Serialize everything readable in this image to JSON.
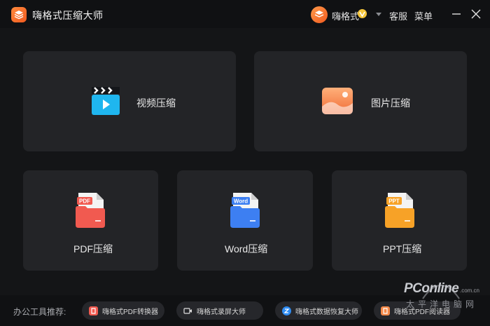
{
  "app": {
    "title": "嗨格式压缩大师"
  },
  "user": {
    "name": "嗨格式"
  },
  "header": {
    "support_label": "客服",
    "menu_label": "菜单"
  },
  "cards": {
    "video": {
      "label": "视频压缩"
    },
    "image": {
      "label": "图片压缩"
    },
    "pdf": {
      "label": "PDF压缩",
      "badge": "PDF"
    },
    "word": {
      "label": "Word压缩",
      "badge": "Word"
    },
    "ppt": {
      "label": "PPT压缩",
      "badge": "PPT"
    }
  },
  "footer": {
    "recommend_label": "办公工具推荐:",
    "tools": [
      {
        "label": "嗨格式PDF转换器"
      },
      {
        "label": "嗨格式录屏大师"
      },
      {
        "label": "嗨格式数据恢复大师"
      },
      {
        "label": "嗨格式PDF阅读器"
      }
    ]
  },
  "watermark": {
    "brand": "PConline",
    "domain": ".com.cn",
    "chinese": "太平洋电脑网"
  },
  "colors": {
    "accent": "#f25a1f",
    "video": "#1fb6ef",
    "image": "#f58a4a",
    "pdf": "#f15a50",
    "word": "#3d7ff2",
    "ppt": "#f7a227"
  }
}
